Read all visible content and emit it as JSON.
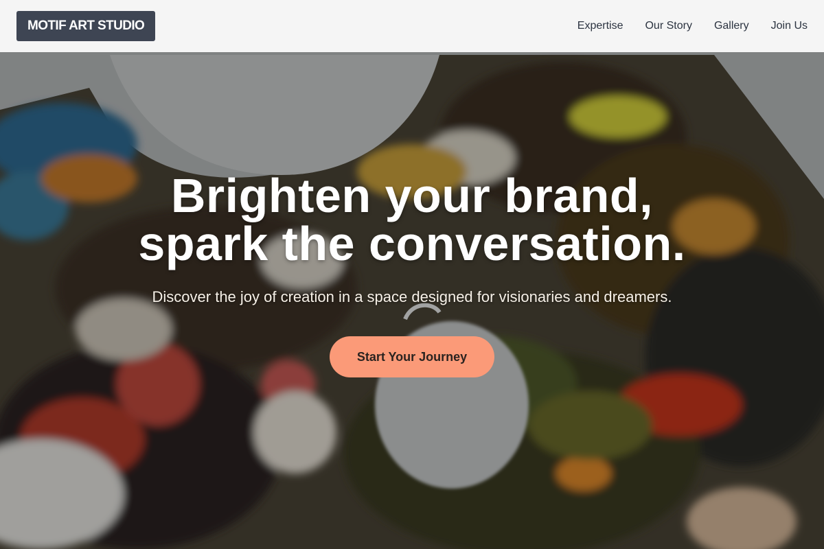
{
  "brand": {
    "name": "MOTIF ART STUDIO"
  },
  "nav": {
    "items": [
      {
        "label": "Expertise"
      },
      {
        "label": "Our Story"
      },
      {
        "label": "Gallery"
      },
      {
        "label": "Join Us"
      }
    ]
  },
  "hero": {
    "headline_line1": "Brighten your brand,",
    "headline_line2": "spark the conversation.",
    "subheadline": "Discover the joy of creation in a space designed for visionaries and dreamers.",
    "cta_label": "Start Your Journey",
    "background_image": "paint-palette-photo"
  },
  "colors": {
    "brand_bg": "#3e4553",
    "cta_bg": "#fb9a78",
    "nav_bg": "#ffffff"
  }
}
